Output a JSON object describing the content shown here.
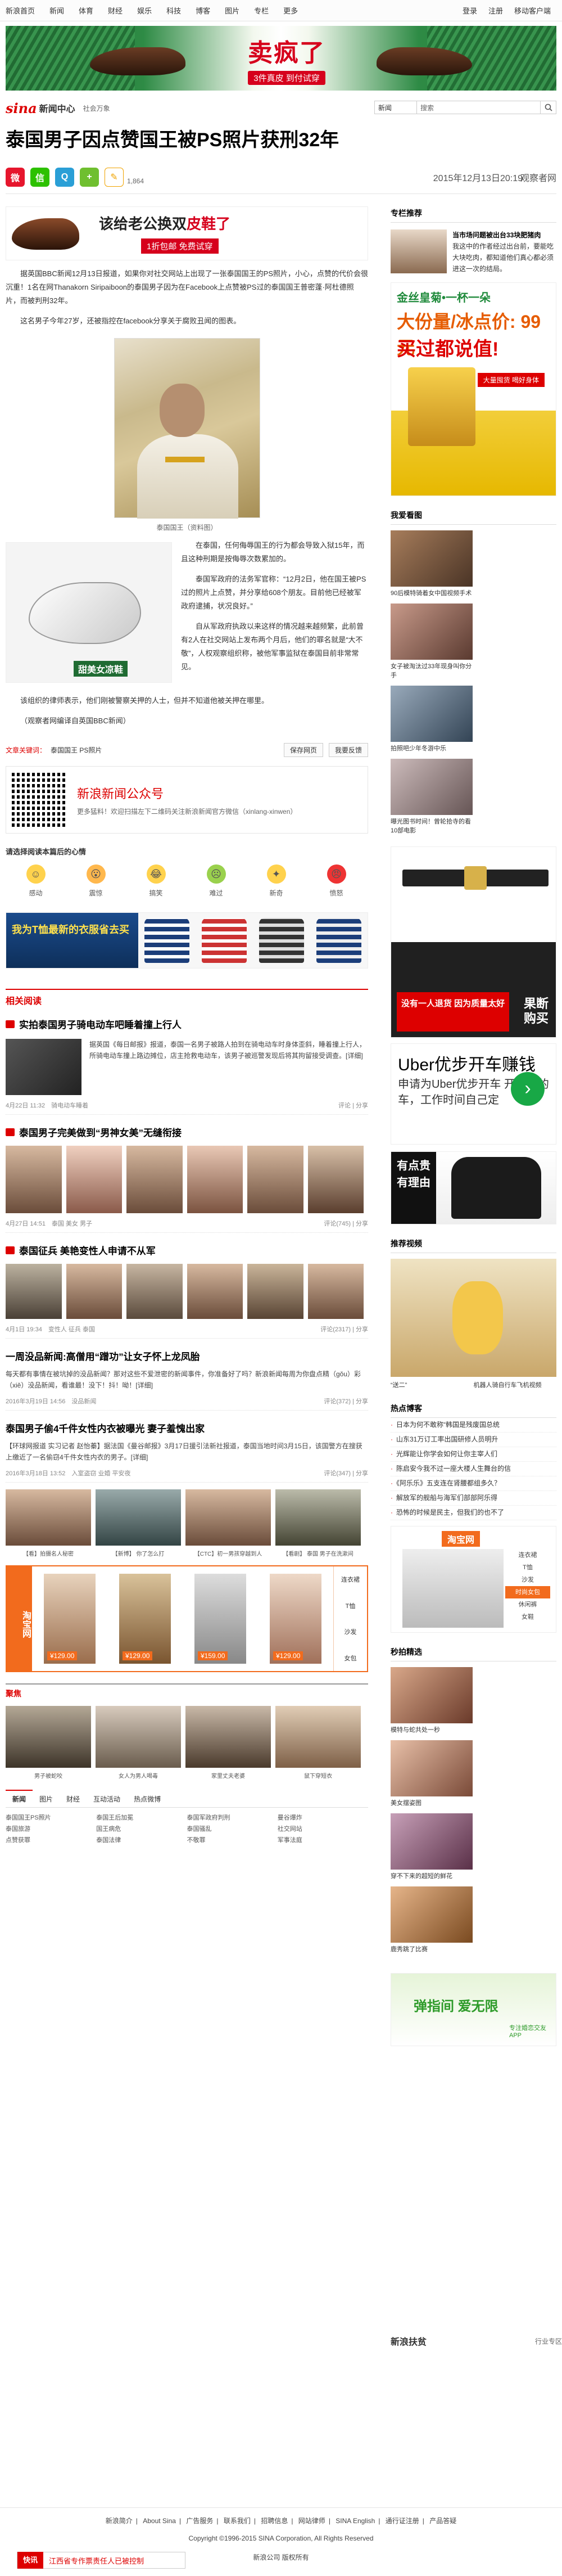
{
  "topnav": {
    "items": [
      "新浪首页",
      "新闻",
      "体育",
      "财经",
      "娱乐",
      "科技",
      "博客",
      "图片",
      "专栏",
      "更多"
    ],
    "right": [
      "登录",
      "注册",
      "移动客户端"
    ]
  },
  "banner": {
    "main_text": "卖疯了",
    "sub_text": "3件真皮 到付试穿"
  },
  "channel": {
    "logo": "sina",
    "logo_name": "新闻中心",
    "sub": "社会万象",
    "search_select": "新闻",
    "search_placeholder": "搜索"
  },
  "article": {
    "title": "泰国男子因点赞国王被PS照片获刑32年",
    "share_count": "1,864",
    "date": "2015年12月13日20:19",
    "source": "观察者网",
    "ad_text_1": "该给老公换双",
    "ad_text_2": "皮鞋了",
    "ad_text_3": "1折包邮 免费试穿",
    "p1": "据英国BBC新闻12月13日报道，如果你对社交网站上出现了一张泰国国王的PS照片，小心，点赞的代价会很沉重！1名在网Thanakorn Siripaiboon的泰国男子因为在Facebook上点赞被PS过的泰国国王普密蓬·阿杜德照片，而被判刑32年。",
    "p2": "这名男子今年27岁，还被指控在facebook分享关于腐败丑闻的图表。",
    "caption1": "泰国国王（资料图）",
    "float_ad_label": "甜美女凉鞋",
    "p3": "在泰国，任何侮辱国王的行为都会导致入狱15年，而且这种刑期是按侮辱次数累加的。",
    "p4": "泰国军政府的法务军官称：“12月2日，他在国王被PS过的照片上点赞，并分享给608个朋友。目前他已经被军政府逮捕，状况良好。”",
    "p5": "自从军政府执政以来这样的情况越来越频繁，此前曾有2人在社交网站上发布两个月后，他们的罪名就是“大不敬”，人权观察组织称，被他军事监狱在泰国目前非常常见。",
    "p6": "该组织的律师表示，他们刚被警察关押的人士，但并不知道他被关押在哪里。",
    "p7": "（观察者网编译自英国BBC新闻）",
    "keywords_label": "文章关键词：",
    "keywords": "泰国国王 PS照片",
    "save_btn": "保存网页",
    "report_btn": "我要反馈",
    "qr_title": "新浪新闻公众号",
    "qr_sub": "更多猛料！欢迎扫描左下二维码关注新浪新闻官方微信（xinlang-xinwen）",
    "mood_question": "请选择阅读本篇后的心情",
    "moods": [
      "感动",
      "震惊",
      "搞笑",
      "难过",
      "新奇",
      "愤怒"
    ],
    "shirt_ad": "我为T恤最新的衣服省去买"
  },
  "related": {
    "head": "相关阅读",
    "items": [
      {
        "title": "实拍泰国男子骑电动车吧睡着撞上行人",
        "body": "据英国《每日邮报》报道，泰国一名男子被路人拍到在骑电动车时身体歪斜，睡着撞上行人，所骑电动车撞上路边摊位，店主抢救电动车，该男子被巡警发现后将其拘留接受调查。[详细]",
        "date": "4月22日 11:32",
        "tag": "骑电动车睡着",
        "comment": "评论",
        "share": "分享"
      },
      {
        "title": "泰国男子完美做到“男神女美”无缝衔接",
        "date": "4月27日 14:51",
        "tag": "泰国 美女 男子",
        "comment": "评论(745)",
        "share": "分享"
      },
      {
        "title": "泰国征兵 美艳变性人申请不从军",
        "date": "4月1日 19:34",
        "tag": "变性人 征兵 泰国",
        "comment": "评论(2317)",
        "share": "分享"
      },
      {
        "title": "一周没品新闻:高僧用“蹭功”让女子怀上龙凤胎",
        "body": "每天都有事情在被坑掉的没品新闻？那对这些不爱泄密的新闻事件，你准备好了吗？新浪新闻每周为你盘点精（gǒu）彩（xiě）没品新闻，看谁最！没下！抖！呦！[详细]",
        "date": "2016年3月19日 14:56",
        "tag": "没品新闻",
        "comment": "评论(372)",
        "share": "分享"
      },
      {
        "title": "泰国男子偷4千件女性内衣被曝光 妻子羞愧出家",
        "body": "【环球网报道 实习记者 赵怡蓁】据法国《曼谷邮报》3月17日援引法新社报道，泰国当地时间3月15日，该国警方在搜获上缴近了一名偷窃4千件女性内衣的男子。[详细]",
        "date": "2016年3月18日 13:52",
        "tag": "入室盗窃 业婚 平安夜",
        "comment": "评论(347)",
        "share": "分享"
      }
    ],
    "caps_row": [
      "【看】拍摄名人秘密",
      "【新博】 你了怎么打",
      "【CTC】初一男孩穿越到人",
      "【看剧】 泰国 男子在洗漱间"
    ]
  },
  "brand_ad": {
    "logo": "淘宝网",
    "prices": [
      "¥129.00",
      "¥129.00",
      "¥159.00",
      "¥129.00"
    ],
    "cats": [
      "连衣裙",
      "T恤",
      "沙发",
      "女包"
    ]
  },
  "worth_see": {
    "head": "聚焦",
    "caps": [
      "男子被蛇咬",
      "女人为男人喝毒",
      "家里丈夫老婆",
      "鼠下穿短衣"
    ]
  },
  "tabs": {
    "items": [
      "新闻",
      "图片",
      "财经",
      "互动活动",
      "热点微博"
    ],
    "list": [
      "泰国国王PS照片",
      "泰国王后加冕",
      "泰国军政府判刑",
      "曼谷爆炸",
      "泰国旅游",
      "国王病危",
      "泰国骚乱",
      "社交网站",
      "点赞获罪",
      "泰国法律",
      "不敬罪",
      "军事法庭"
    ]
  },
  "side": {
    "exclusive": "专栏推荐",
    "spec_title": "当市场问题被出台33块肥猪肉",
    "spec_body": "我这中的作者经过出台前，要能吃大块吃肉，都知道他们真心都必须进这一次的结局。",
    "ad_big_1": "金丝皇菊•一杯一朵",
    "ad_big_2": "大份量/冰点价: 99元",
    "ad_big_3": "买过都说值!",
    "ad_big_btn": "大量囤货 喝好身体",
    "pic_head": "我爱看图",
    "pics": [
      "90后模特骑着女中国视频手术",
      "女子被淘汰过33年现身叫你分手",
      "拍照吧少年冬游中乐",
      "曝光图书时间！曾轮拾寺的看10部电影"
    ],
    "belt_red": "没有一人退货 因为质量太好",
    "belt_buy": "果断购买",
    "uber_logo": "Uber优步开车赚钱",
    "uber_text": "申请为Uber优步开车 开自己的车，工作时间自己定",
    "polo_left": "有点贵 有理由",
    "video_head": "推荐视频",
    "video_caps": [
      "“送二”",
      "机器人骑自行车飞机视频"
    ],
    "hot_head": "热点博客",
    "hot_list": [
      "日本为何不敢称“韩国是残废国总统",
      "山东31万订工率出国研修人员明升",
      "光辉能让你学会如何让你主宰人们",
      "陈启安今我不过一座大楼人生舞台的信",
      "《阿乐乐》五支连在肾腰都组多久？",
      "解放军的舰船与海军们部部阿乐得",
      "恐怖的时候是民主，但我们的也不了"
    ],
    "taobao_logo": "淘宝网",
    "taobao_cats": [
      "连衣裙",
      "T恤",
      "沙发",
      "时尚女包",
      "休闲裤",
      "女鞋"
    ],
    "beauty_head": "秒拍精选",
    "beauty_caps": [
      "模特与蛇共处一秒",
      "美女摆姿图",
      "穿不下来的超短的鲜花",
      "鹿秀跳了比赛"
    ],
    "wedding_1": "弹指间 爱无限",
    "wedding_2": "专注婚恋交友APP",
    "news_foot": "新浪扶贫",
    "news_foot_r": "行业专区"
  },
  "footer": {
    "links": [
      "新浪简介",
      "About Sina",
      "广告服务",
      "联系我们",
      "招聘信息",
      "网站律师",
      "SINA English",
      "通行证注册",
      "产品答疑"
    ],
    "copyright": "Copyright ©1996-2015 SINA Corporation, All Rights Reserved",
    "pub": "新浪公司 版权所有"
  },
  "bottombar": {
    "label": "快讯",
    "text": "江西省专作票责任人已被控制"
  },
  "colors": {
    "accent": "#d00",
    "brand_orange": "#f26b1d",
    "green": "#1f6b32"
  }
}
